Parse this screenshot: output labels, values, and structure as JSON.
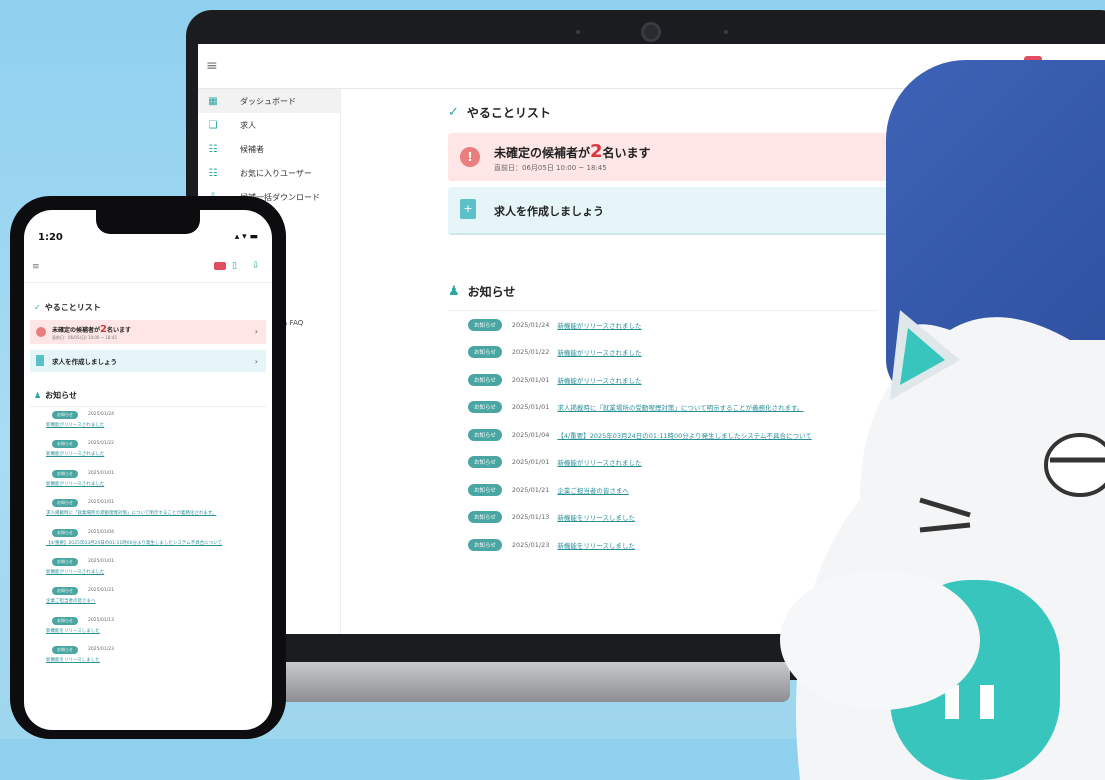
{
  "laptop": {
    "sidebar": {
      "items": [
        {
          "label": "ダッシュボード",
          "icon": "dashboard-icon",
          "active": true
        },
        {
          "label": "求人",
          "icon": "job-icon"
        },
        {
          "label": "候補者",
          "icon": "candidates-icon"
        },
        {
          "label": "お気に入りユーザー",
          "icon": "favorite-users-icon"
        },
        {
          "label": "候補一括ダウンロード",
          "icon": "download-icon"
        }
      ],
      "faq": "& FAQ"
    },
    "todo": {
      "title": "やることリスト",
      "item1_prefix": "未確定の候補者が",
      "item1_count": "2",
      "item1_suffix": "名います",
      "item1_sub": "直前日：06月05日 10:00 ~ 18:45",
      "item2": "求人を作成しましょう"
    },
    "news": {
      "title": "お知らせ",
      "items": [
        {
          "badge": "お知らせ",
          "date": "2025/01/24",
          "text": "新機能がリリースされました"
        },
        {
          "badge": "お知らせ",
          "date": "2025/01/22",
          "text": "新機能がリリースされました"
        },
        {
          "badge": "お知らせ",
          "date": "2025/01/01",
          "text": "新機能がリリースされました"
        },
        {
          "badge": "お知らせ",
          "date": "2025/01/01",
          "text": "求人掲載時に「就業場所の受動喫煙対策」について明示することが義務化されます。"
        },
        {
          "badge": "お知らせ",
          "date": "2025/01/04",
          "text": "【4/重要】2025年03月24日の01:11時00分より発生しましたシステム不具合について"
        },
        {
          "badge": "お知らせ",
          "date": "2025/01/01",
          "text": "新機能がリリースされました"
        },
        {
          "badge": "お知らせ",
          "date": "2025/01/21",
          "text": "企業ご担当者の皆さまへ"
        },
        {
          "badge": "お知らせ",
          "date": "2025/01/13",
          "text": "新機能をリリースしました"
        },
        {
          "badge": "お知らせ",
          "date": "2025/01/23",
          "text": "新機能をリリースしました"
        }
      ]
    }
  },
  "phone": {
    "status": {
      "time": "1:20",
      "icons": "▴ ▾ ▬"
    },
    "todo": {
      "title": "やることリスト",
      "item1_prefix": "未確定の候補者が",
      "item1_count": "2",
      "item1_suffix": "名います",
      "item1_sub": "直前日：06/05(日) 10:00 ~ 18:45",
      "item2": "求人を作成しましょう"
    },
    "news": {
      "title": "お知らせ",
      "items": [
        {
          "badge": "お知らせ",
          "date": "2025/01/24",
          "text": "新機能がリリースされました"
        },
        {
          "badge": "お知らせ",
          "date": "2025/01/22",
          "text": "新機能がリリースされました"
        },
        {
          "badge": "お知らせ",
          "date": "2025/01/01",
          "text": "新機能がリリースされました"
        },
        {
          "badge": "お知らせ",
          "date": "2025/01/01",
          "text": "求人掲載時に「就業場所の受動喫煙対策」について明示することが義務化されます。"
        },
        {
          "badge": "お知らせ",
          "date": "2025/01/04",
          "text": "【4/重要】2025年03月24日の01:11時00分より発生しましたシステム不具合について"
        },
        {
          "badge": "お知らせ",
          "date": "2025/01/01",
          "text": "新機能がリリースされました"
        },
        {
          "badge": "お知らせ",
          "date": "2025/01/21",
          "text": "企業ご担当者の皆さまへ"
        },
        {
          "badge": "お知らせ",
          "date": "2025/01/13",
          "text": "新機能をリリースしました"
        },
        {
          "badge": "お知らせ",
          "date": "2025/01/23",
          "text": "新機能をリリースしました"
        }
      ]
    }
  },
  "colors": {
    "accent": "#2ba6a3",
    "alert_bg": "#fde6e5",
    "alert_num": "#d9363e",
    "info_bg": "#e6f5f8",
    "badge": "#4aa6a3",
    "link": "#2b8f9a"
  }
}
